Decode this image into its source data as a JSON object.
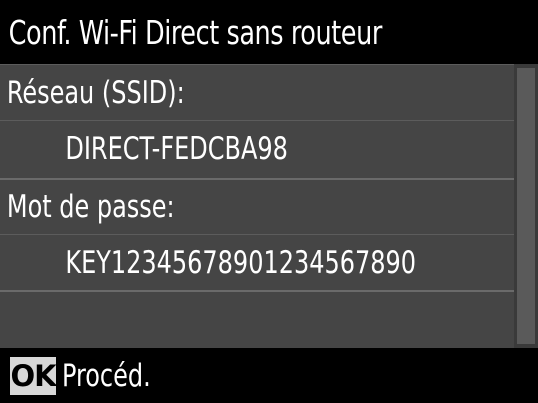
{
  "title": "Conf. Wi-Fi Direct sans routeur",
  "network": {
    "label": "Réseau (SSID):",
    "value": "DIRECT-FEDCBA98"
  },
  "password": {
    "label": "Mot de passe:",
    "value": "KEY12345678901234567890"
  },
  "footer": {
    "button": "OK",
    "action": "Procéd."
  },
  "colors": {
    "background": "#000000",
    "panel": "#454545",
    "text": "#ffffff",
    "ok_badge": "#d8d8d8"
  }
}
